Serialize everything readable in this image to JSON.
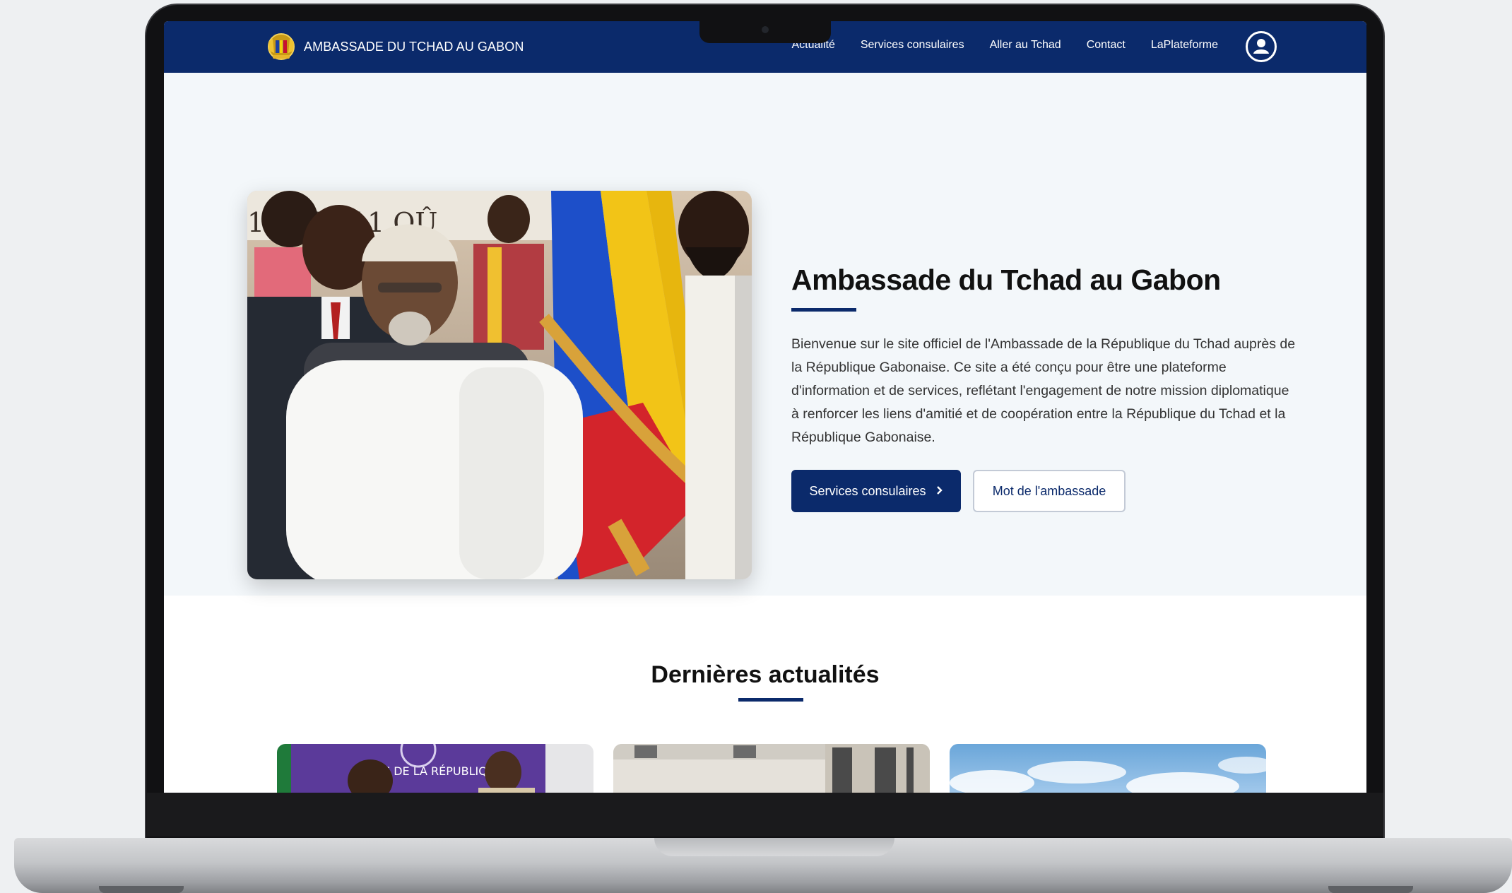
{
  "nav": {
    "brand": "AMBASSADE DU TCHAD AU GABON",
    "items": [
      "Actualité",
      "Services consulaires",
      "Aller au Tchad",
      "Contact",
      "LaPlateforme"
    ]
  },
  "hero": {
    "title": "Ambassade du Tchad au Gabon",
    "text": "Bienvenue sur le site officiel de l'Ambassade de la République du Tchad auprès de la République Gabonaise. Ce site a été conçu pour être une plateforme d'information et de services, reflétant l'engagement de notre mission diplomatique à renforcer les liens d'amitié et de coopération entre la République du Tchad et la République Gabonaise.",
    "primary_button": "Services consulaires",
    "secondary_button": "Mot de l'ambassade",
    "banner_text": "1   1960-11 OÛ"
  },
  "news": {
    "title": "Dernières actualités",
    "card1_banner": "E DE LA RÉPUBLIQUE"
  },
  "colors": {
    "primary": "#0b2a6b",
    "hero_bg": "#f3f7fa"
  }
}
